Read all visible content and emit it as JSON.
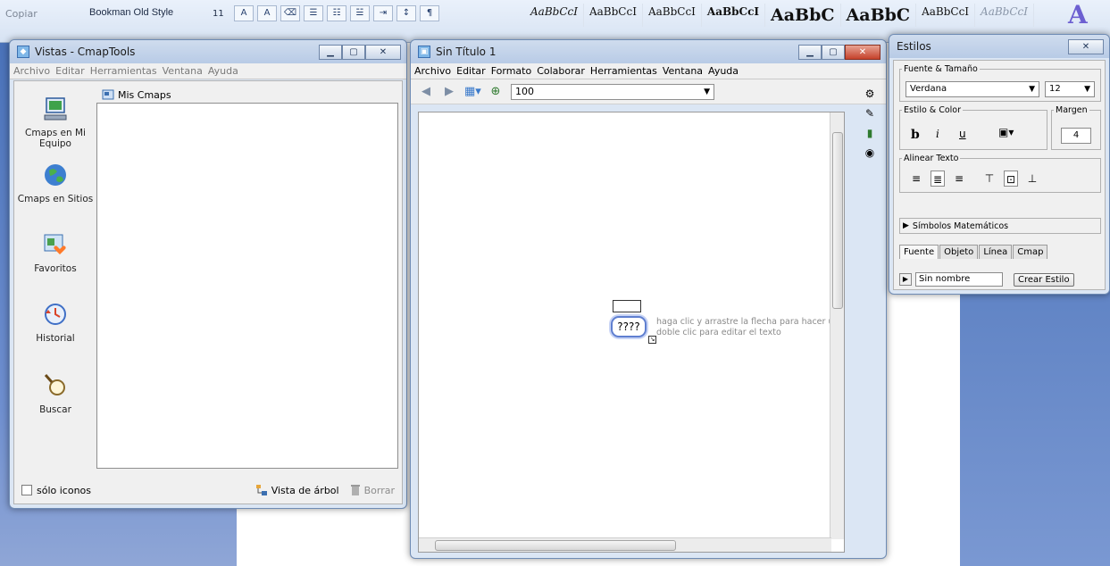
{
  "background": {
    "copy_label": "Copiar",
    "font_name": "Bookman Old Style",
    "font_size": "11",
    "style_samples": [
      "AaBbCcI",
      "AaBbCcI",
      "AaBbCcI",
      "AaBbCcI",
      "AaBbC",
      "AaBbC",
      "AaBbCcI",
      "AaBbCcI"
    ]
  },
  "vistas": {
    "title": "Vistas - CmapTools",
    "menu": [
      "Archivo",
      "Editar",
      "Herramientas",
      "Ventana",
      "Ayuda"
    ],
    "sidebar": [
      {
        "label": "Cmaps en Mi Equipo",
        "icon": "computer-icon"
      },
      {
        "label": "Cmaps en Sitios",
        "icon": "globe-icon"
      },
      {
        "label": "Favoritos",
        "icon": "favorites-icon"
      },
      {
        "label": "Historial",
        "icon": "history-icon"
      },
      {
        "label": "Buscar",
        "icon": "search-icon"
      }
    ],
    "folder_title": "Mis Cmaps",
    "only_icons_label": "sólo iconos",
    "tree_view_label": "Vista de árbol",
    "delete_label": "Borrar"
  },
  "cmap": {
    "title": "Sin Título 1",
    "menu": [
      "Archivo",
      "Editar",
      "Formato",
      "Colaborar",
      "Herramientas",
      "Ventana",
      "Ayuda"
    ],
    "zoom": "100",
    "concept_text": "????",
    "tip_line1": "haga clic y arrastre la flecha para hacer u",
    "tip_line2": "doble clic para editar el texto"
  },
  "estilos": {
    "title": "Estilos",
    "font_section": "Fuente & Tamaño",
    "font_value": "Verdana",
    "size_value": "12",
    "style_section": "Estilo & Color",
    "margin_section": "Margen",
    "margin_value": "4",
    "bold": "b",
    "italic": "i",
    "underline": "u",
    "align_section": "Alinear Texto",
    "math_label": "Símbolos Matemáticos",
    "tabs": [
      "Fuente",
      "Objeto",
      "Línea",
      "Cmap"
    ],
    "style_name": "Sin nombre",
    "create_style_label": "Crear Estilo"
  }
}
